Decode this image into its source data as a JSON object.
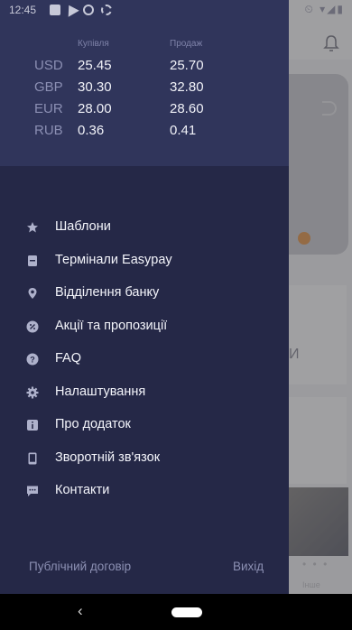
{
  "status_bar": {
    "time": "12:45",
    "right_icons": "⏲ ▾◢▮"
  },
  "rates": {
    "buy_header": "Купівля",
    "sell_header": "Продаж",
    "rows": [
      {
        "currency": "USD",
        "buy": "25.45",
        "sell": "25.70"
      },
      {
        "currency": "GBP",
        "buy": "30.30",
        "sell": "32.80"
      },
      {
        "currency": "EUR",
        "buy": "28.00",
        "sell": "28.60"
      },
      {
        "currency": "RUB",
        "buy": "0.36",
        "sell": "0.41"
      }
    ]
  },
  "menu": {
    "items": [
      {
        "label": "Шаблони",
        "icon": "star-icon"
      },
      {
        "label": "Термінали Easypay",
        "icon": "terminal-icon"
      },
      {
        "label": "Відділення банку",
        "icon": "location-pin-icon"
      },
      {
        "label": "Акції та пропозиції",
        "icon": "percent-icon"
      },
      {
        "label": "FAQ",
        "icon": "question-icon"
      },
      {
        "label": "Налаштування",
        "icon": "gear-icon"
      },
      {
        "label": "Про додаток",
        "icon": "info-icon"
      },
      {
        "label": "Зворотній зв'язок",
        "icon": "phone-icon"
      },
      {
        "label": "Контакти",
        "icon": "chat-icon"
      }
    ]
  },
  "footer": {
    "contract": "Публічний договір",
    "logout": "Вихід"
  },
  "background": {
    "more_label": "Інше"
  },
  "nav": {
    "back": "‹"
  },
  "colors": {
    "drawer": "#252847",
    "drawer_header": "#30355b",
    "text_muted": "#8b8fb3"
  }
}
